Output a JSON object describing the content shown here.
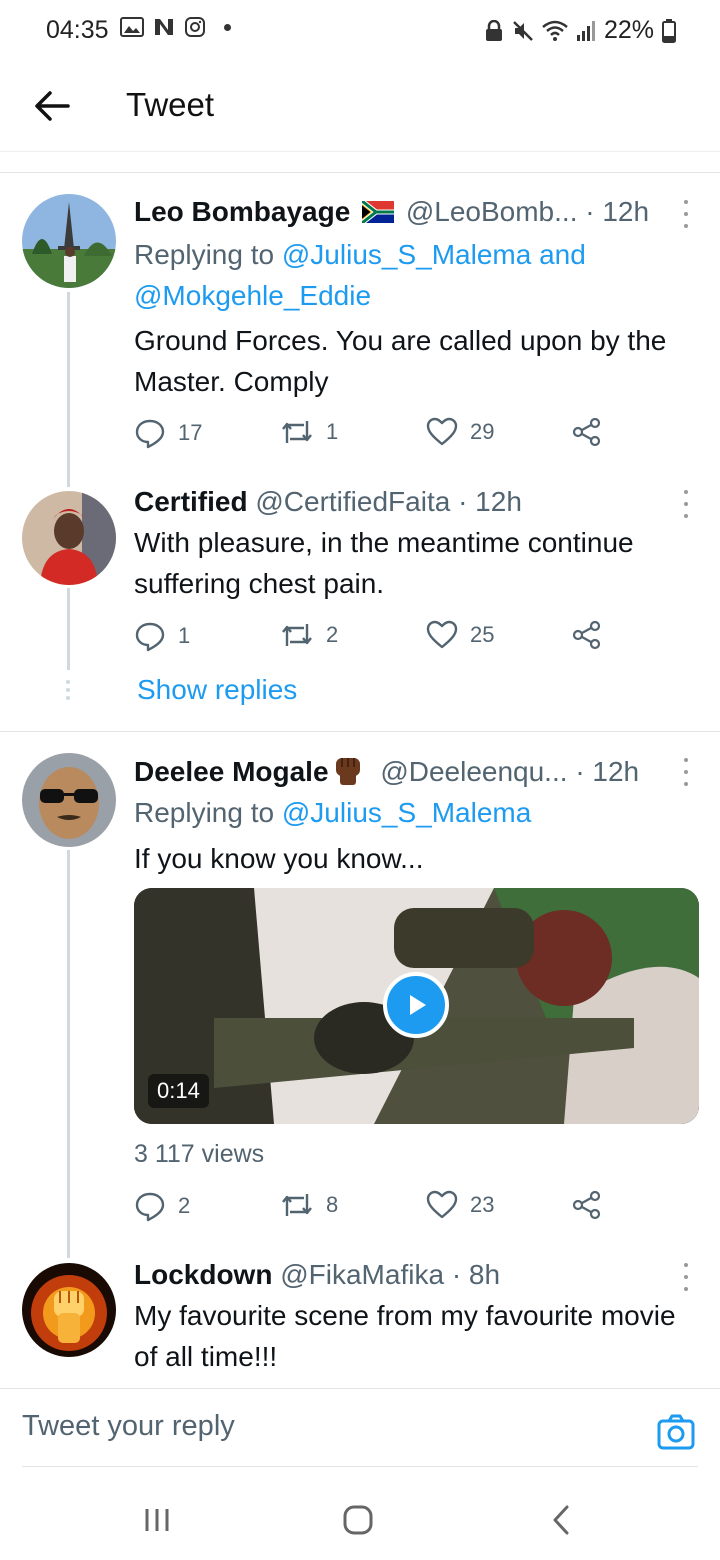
{
  "status_bar": {
    "time": "04:35",
    "battery": "22%"
  },
  "header": {
    "title": "Tweet"
  },
  "tweets": [
    {
      "name": "Leo Bombayage",
      "handle": "@LeoBomb...",
      "time": "· 12h",
      "replying_prefix": "Replying to",
      "mentions": [
        "@Julius_S_Malema",
        "@Mokgehle_Eddie"
      ],
      "mention_joiner": "and",
      "text": "Ground Forces. You are called upon by the Master. Comply",
      "replies": "17",
      "retweets": "1",
      "likes": "29"
    },
    {
      "name": "Certified",
      "handle": "@CertifiedFaita",
      "time": "· 12h",
      "text": "With pleasure, in the meantime continue suffering chest pain.",
      "replies": "1",
      "retweets": "2",
      "likes": "25"
    },
    {
      "name": "Deelee Mogale",
      "handle": "@Deeleenqu...",
      "time": "· 12h",
      "replying_prefix": "Replying to",
      "mentions": [
        "@Julius_S_Malema"
      ],
      "text": "If you know you know...",
      "video_duration": "0:14",
      "views": "3 117 views",
      "replies": "2",
      "retweets": "8",
      "likes": "23"
    },
    {
      "name": "Lockdown",
      "handle": "@FikaMafika",
      "time": "· 8h",
      "text": "My favourite scene from my favourite movie of all time!!!"
    }
  ],
  "show_replies": "Show replies",
  "reply_box": {
    "placeholder": "Tweet your reply"
  },
  "icons": {
    "back": "arrow-left-icon",
    "reply": "speech-bubble-icon",
    "retweet": "retweet-icon",
    "like": "heart-icon",
    "share": "share-icon",
    "camera": "camera-icon"
  },
  "colors": {
    "accent": "#1d9bf0",
    "text": "#0f1419",
    "muted": "#536471"
  }
}
